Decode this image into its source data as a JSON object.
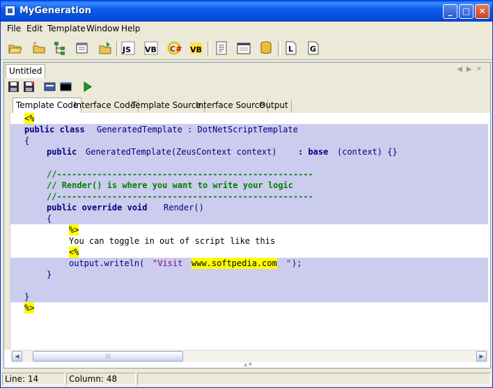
{
  "window": {
    "title": "MyGeneration"
  },
  "menu": [
    "File",
    "Edit",
    "Template",
    "Window",
    "Help"
  ],
  "toolbar_icons": [
    "open-folder-icon",
    "folder-icon",
    "tree-icon",
    "window-icon",
    "open-folder-arrow-icon",
    "js-script-icon",
    "vb-script-icon",
    "csharp-script-icon",
    "vb-alt-script-icon",
    "document-list-icon",
    "window-list-icon",
    "database-icon",
    "l-document-icon",
    "g-document-icon"
  ],
  "document": {
    "tab": "Untitled",
    "toolbar_icons": [
      "save-icon",
      "save-as-icon",
      "properties-icon",
      "console-icon",
      "run-icon"
    ],
    "code_tabs": [
      "Template Code",
      "Interface Code",
      "Template Source",
      "Interface Source",
      "Output"
    ],
    "active_tab": "Template Code"
  },
  "code": {
    "l01": "<%",
    "l02a": "public class ",
    "l02b": "GeneratedTemplate : DotNetScriptTemplate",
    "l03": "{",
    "l04a": "public ",
    "l04b": "GeneratedTemplate(ZeusContext context) ",
    "l04c": ": base",
    "l04d": "(context) {}",
    "l06": "//---------------------------------------------------",
    "l07": "// Render() is where you want to write your logic",
    "l08": "//---------------------------------------------------",
    "l09a": "public override void ",
    "l09b": "Render()",
    "l10": "{",
    "l11": "%>",
    "l12": "You can toggle in out of script like this",
    "l13": "<%",
    "l14a": "output.writeln(",
    "l14b": "\"Visit ",
    "l14c": "www.softpedia.com",
    "l14d": "\"",
    "l14e": ");",
    "l15": "}",
    "l17": "}",
    "l18": "%>"
  },
  "status": {
    "line": "Line: 14",
    "column": "Column: 48"
  },
  "colors": {
    "selection": "#CCCCEE",
    "keyword": "#00007F",
    "comment": "#007F00",
    "string": "#7F007F",
    "marker": "#FFFF00"
  }
}
